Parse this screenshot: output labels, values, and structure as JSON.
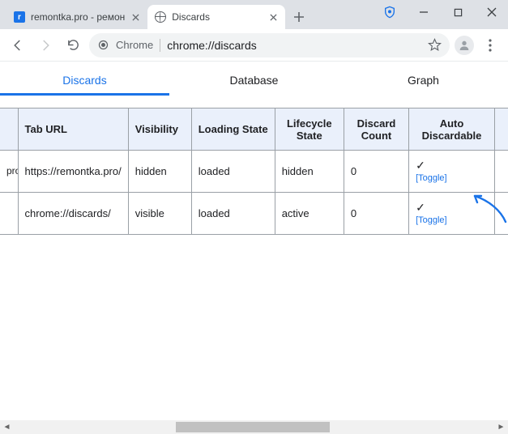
{
  "window": {
    "tabs": [
      {
        "title": "remontka.pro - ремон",
        "favicon": "r"
      },
      {
        "title": "Discards",
        "favicon": "globe"
      }
    ],
    "active_tab_index": 1
  },
  "toolbar": {
    "chrome_label": "Chrome",
    "url": "chrome://discards"
  },
  "page_tabs": {
    "items": [
      "Discards",
      "Database",
      "Graph"
    ],
    "active_index": 0
  },
  "table": {
    "left_fragment_header": "",
    "left_fragment_cells": [
      "pro - ров,",
      ""
    ],
    "columns": [
      "Tab URL",
      "Visibility",
      "Loading State",
      "Lifecycle State",
      "Discard Count",
      "Auto Discardable"
    ],
    "rows": [
      {
        "url": "https://remontka.pro/",
        "visibility": "hidden",
        "loading": "loaded",
        "lifecycle": "hidden",
        "discard_count": "0",
        "auto_check": "✓",
        "toggle": "Toggle"
      },
      {
        "url": "chrome://discards/",
        "visibility": "visible",
        "loading": "loaded",
        "lifecycle": "active",
        "discard_count": "0",
        "auto_check": "✓",
        "toggle": "Toggle"
      }
    ]
  }
}
